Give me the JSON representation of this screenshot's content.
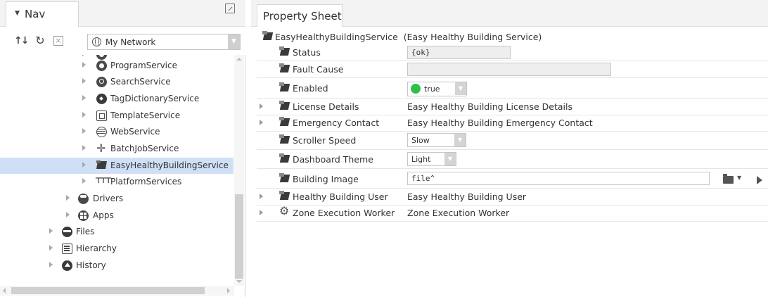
{
  "nav": {
    "title": "Nav",
    "network_select": "My Network",
    "tree": [
      {
        "label": "ProgramService",
        "icon": "program-icon"
      },
      {
        "label": "SearchService",
        "icon": "search-icon"
      },
      {
        "label": "TagDictionaryService",
        "icon": "tag-icon"
      },
      {
        "label": "TemplateService",
        "icon": "template-icon"
      },
      {
        "label": "WebService",
        "icon": "web-icon"
      },
      {
        "label": "BatchJobService",
        "icon": "batch-icon"
      },
      {
        "label": "EasyHealthyBuildingService",
        "icon": "service-icon",
        "selected": true
      },
      {
        "label": "PlatformServices",
        "icon": "platform-icon"
      },
      {
        "label": "Drivers",
        "icon": "drivers-icon"
      },
      {
        "label": "Apps",
        "icon": "apps-icon"
      },
      {
        "label": "Files",
        "icon": "files-icon"
      },
      {
        "label": "Hierarchy",
        "icon": "hierarchy-icon"
      },
      {
        "label": "History",
        "icon": "history-icon"
      }
    ]
  },
  "sheet": {
    "tab": "Property Sheet",
    "root_name": "EasyHealthyBuildingService",
    "root_desc": "(Easy Healthy Building Service)",
    "rows": [
      {
        "name": "Status",
        "value": "{ok}"
      },
      {
        "name": "Fault Cause",
        "value": ""
      },
      {
        "name": "Enabled",
        "value": "true"
      },
      {
        "name": "License Details",
        "value": "Easy Healthy Building License Details"
      },
      {
        "name": "Emergency Contact",
        "value": "Easy Healthy Building Emergency Contact"
      },
      {
        "name": "Scroller Speed",
        "value": "Slow"
      },
      {
        "name": "Dashboard Theme",
        "value": "Light"
      },
      {
        "name": "Building Image",
        "value": "file^"
      },
      {
        "name": "Healthy Building User",
        "value": "Easy Healthy Building User"
      },
      {
        "name": "Zone Execution Worker",
        "value": "Zone Execution Worker"
      }
    ]
  },
  "colors": {
    "selection": "#cfe0f6",
    "enabled_dot": "#2fbf4a"
  }
}
